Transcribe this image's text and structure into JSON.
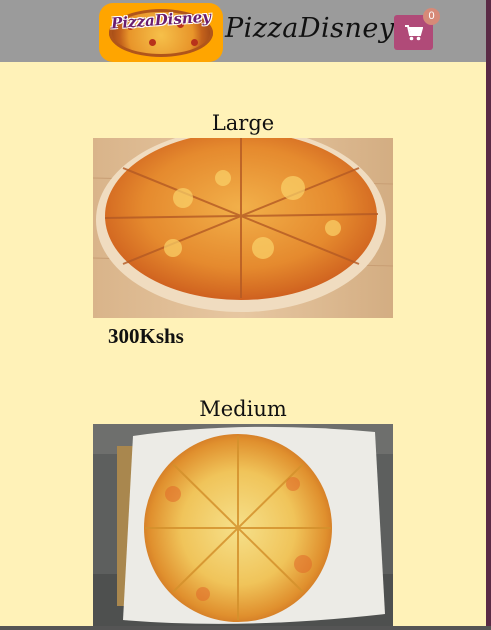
{
  "header": {
    "logo_text": "PizzaDisney",
    "brand_name": "PizzaDisney",
    "cart_count": "0",
    "cart_icon": "shopping-cart-icon"
  },
  "products": [
    {
      "size": "Large",
      "price": "300Kshs",
      "image": "cheese-pizza-on-wooden-board"
    },
    {
      "size": "Medium",
      "image": "cheese-pizza-on-parchment"
    }
  ],
  "colors": {
    "page_background": "#fff2b8",
    "header_background": "#9b9b9b",
    "logo_background": "#ffa500",
    "cart_button": "#b04a78",
    "cart_badge": "#d68a78"
  }
}
